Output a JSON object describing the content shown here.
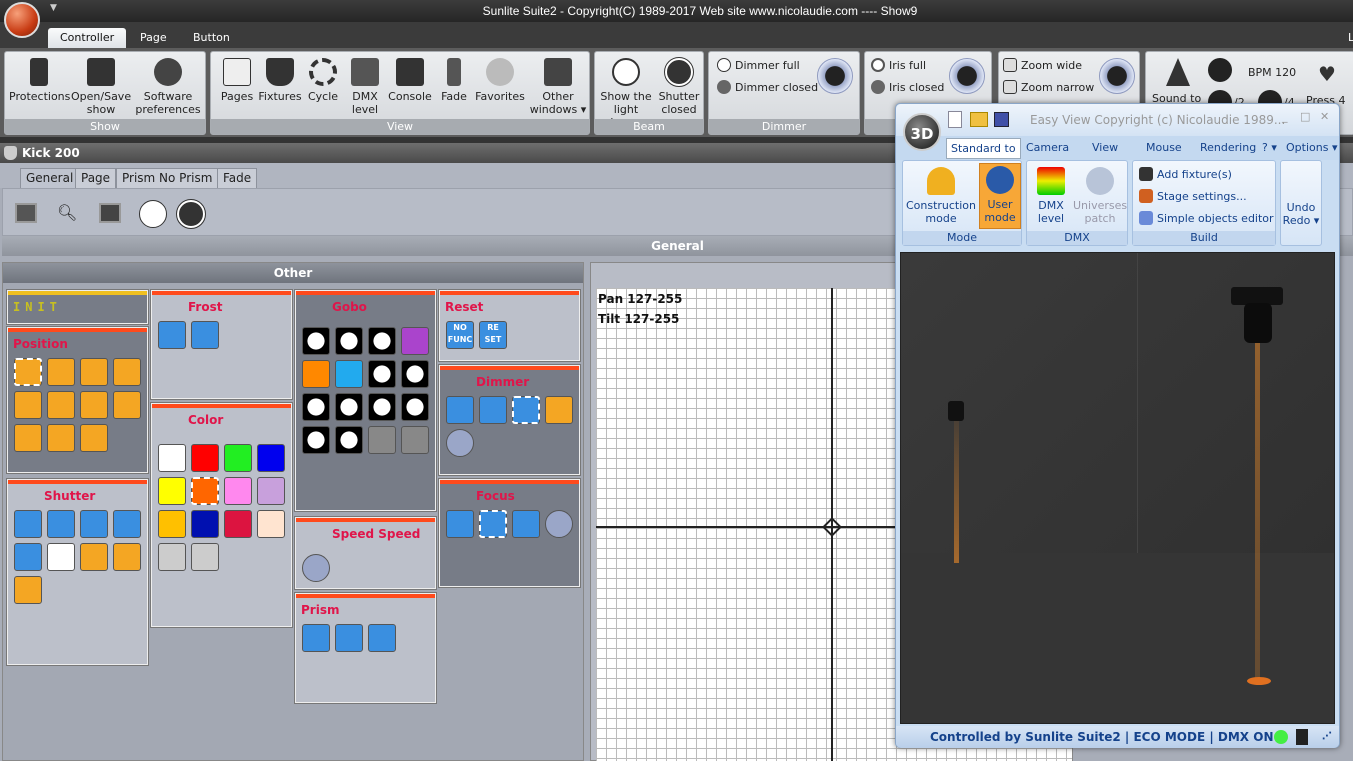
{
  "app": {
    "title": "Sunlite Suite2 - Copyright(C) 1989-2017    Web site www.nicolaudie.com ---- Show9"
  },
  "ribbon_tabs": [
    {
      "label": "Controller",
      "active": true
    },
    {
      "label": "Page"
    },
    {
      "label": "Button"
    }
  ],
  "ribbon_right_label": "L",
  "ribbon": {
    "show": {
      "label": "Show",
      "buttons": [
        {
          "label": "Protections",
          "icon": "lock-icon"
        },
        {
          "label": "Open/Save show",
          "icon": "folder-icon"
        },
        {
          "label": "Software preferences ▾",
          "icon": "gear-icon"
        }
      ]
    },
    "view": {
      "label": "View",
      "buttons": [
        {
          "label": "Pages",
          "icon": "pages-icon"
        },
        {
          "label": "Fixtures",
          "icon": "fixture-icon"
        },
        {
          "label": "Cycle",
          "icon": "cycle-icon"
        },
        {
          "label": "DMX level",
          "icon": "dmx-level-icon"
        },
        {
          "label": "Console",
          "icon": "console-icon"
        },
        {
          "label": "Fade",
          "icon": "fade-icon"
        },
        {
          "label": "Favorites",
          "icon": "favorites-icon"
        },
        {
          "label": "Other windows ▾",
          "icon": "window-icon"
        }
      ]
    },
    "beam": {
      "label": "Beam",
      "buttons": [
        {
          "label": "Show the light beam",
          "icon": "white-circle-icon"
        },
        {
          "label": "Shutter closed",
          "icon": "black-circle-icon"
        }
      ]
    },
    "dimmer": {
      "label": "Dimmer",
      "items": [
        "Dimmer full",
        "Dimmer closed"
      ]
    },
    "iris": {
      "items": [
        "Iris full",
        "Iris closed"
      ]
    },
    "zoom": {
      "items": [
        "Zoom wide",
        "Zoom narrow"
      ]
    },
    "sound": {
      "sound_to": "Sound to",
      "bpm": "BPM 120",
      "div2": "/2",
      "div4": "/4",
      "press": "Press 4"
    }
  },
  "fixture": {
    "name": "Kick 200",
    "tabs": [
      {
        "label": "General",
        "active": true
      },
      {
        "label": "Page"
      },
      {
        "label": "Prism No Prism"
      },
      {
        "label": "Fade"
      }
    ],
    "section": "General"
  },
  "other": {
    "title": "Other",
    "cards": [
      {
        "id": "init",
        "title": "INIT",
        "dark": true,
        "icons": []
      },
      {
        "id": "position",
        "title": "Position",
        "dark": true,
        "icons": [
          "#f4a623",
          "#f4a623",
          "#f4a623",
          "#f4a623",
          "#f4a623",
          "#f4a623",
          "#f4a623",
          "#f4a623",
          "#f4a623",
          "#f4a623",
          "#f4a623"
        ]
      },
      {
        "id": "shutter",
        "title": "Shutter",
        "icons": [
          "#3a8fe0",
          "#3a8fe0",
          "#3a8fe0",
          "#3a8fe0",
          "#3a8fe0",
          "#ffffff",
          "#f4a623",
          "#f4a623",
          "#f4a623"
        ]
      },
      {
        "id": "frost",
        "title": "Frost",
        "icons": [
          "#3a8fe0",
          "#3a8fe0"
        ]
      },
      {
        "id": "color",
        "title": "Color",
        "icons": [
          "#ffffff",
          "#ff0000",
          "#22ee22",
          "#0000ee",
          "#ffff00",
          "#ff6600",
          "#ff88ee",
          "#c8a0dc",
          "#ffc000",
          "#0010b0",
          "#dc1440",
          "#ffe4d0",
          "#cccccc",
          "#cccccc"
        ]
      },
      {
        "id": "gobo",
        "title": "Gobo",
        "dark": true,
        "icons": [
          "#000",
          "#000",
          "#000",
          "#aa44cc",
          "#ff8800",
          "#22aaee",
          "#000",
          "#000",
          "#000",
          "#000",
          "#000",
          "#000",
          "#000",
          "#000",
          "#888",
          "#888"
        ]
      },
      {
        "id": "speed",
        "title": "Speed Speed",
        "icons": [
          "#9aa6c8"
        ]
      },
      {
        "id": "prism",
        "title": "Prism",
        "icons": [
          "#3a8fe0",
          "#3a8fe0",
          "#3a8fe0"
        ]
      },
      {
        "id": "reset",
        "title": "Reset",
        "icons": [
          "#3a8fe0",
          "#3a8fe0"
        ],
        "icon_labels": [
          "NO FUNC",
          "RE SET"
        ]
      },
      {
        "id": "dimmer",
        "title": "Dimmer",
        "dark": true,
        "icons": [
          "#3a8fe0",
          "#3a8fe0",
          "#3a8fe0",
          "#f4a623",
          "#9aa6c8"
        ]
      },
      {
        "id": "focus",
        "title": "Focus",
        "dark": true,
        "icons": [
          "#3a8fe0",
          "#3a8fe0",
          "#3a8fe0",
          "#9aa6c8"
        ]
      }
    ]
  },
  "grid": {
    "pan": "Pan 127-255",
    "tilt": "Tilt 127-255"
  },
  "easyview": {
    "title": "Easy View   Copyright (c) Nicolaudie 1989...",
    "tabs": [
      "Standard to",
      "Camera",
      "View",
      "Mouse",
      "Rendering",
      "? ▾",
      "Options ▾"
    ],
    "mode": {
      "label": "Mode",
      "construction": "Construction mode",
      "user": "User mode"
    },
    "dmx": {
      "label": "DMX",
      "level": "DMX level",
      "patch": "Universes patch"
    },
    "build": {
      "label": "Build",
      "items": [
        "Add fixture(s)",
        "Stage settings...",
        "Simple objects editor"
      ]
    },
    "undo": "Undo",
    "redo": "Redo ▾",
    "status": "Controlled by Sunlite Suite2  |  ECO MODE  |  DMX ON",
    "accent": "#f7a737"
  }
}
